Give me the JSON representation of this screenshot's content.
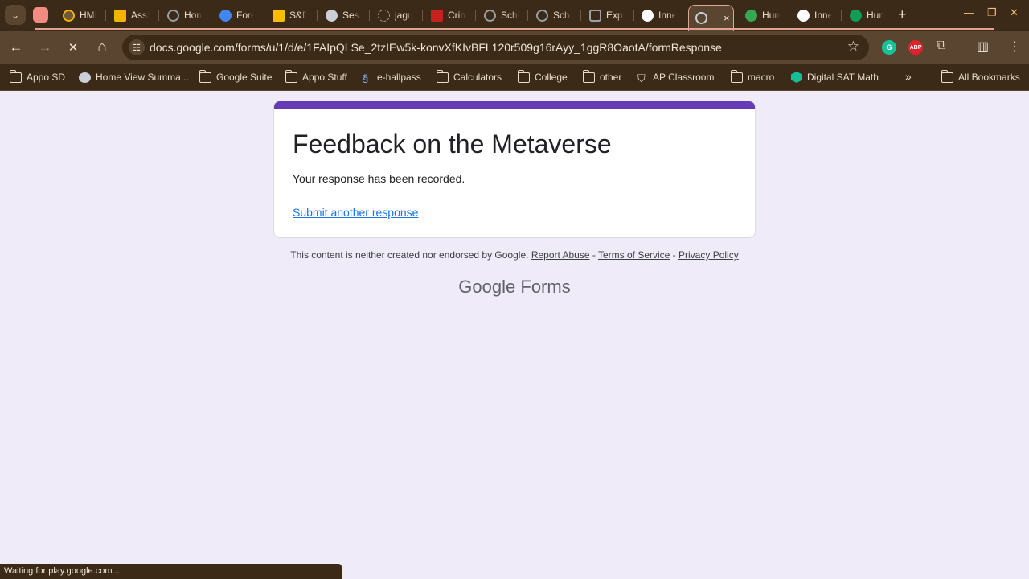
{
  "tabs": [
    {
      "label": "HMI",
      "fav_color": "#f4b400"
    },
    {
      "label": "Assignments",
      "fav_color": "#f4b400"
    },
    {
      "label": "Home",
      "fav_color": "#9aa0a6"
    },
    {
      "label": "Forest",
      "fav_color": "#4285f4"
    },
    {
      "label": "S&D",
      "fav_color": "#fbbc04"
    },
    {
      "label": "Session",
      "fav_color": "#9aa0a6"
    },
    {
      "label": "jaguar",
      "fav_color": "#9aa0a6"
    },
    {
      "label": "Crim",
      "fav_color": "#c5221f"
    },
    {
      "label": "School",
      "fav_color": "#9aa0a6"
    },
    {
      "label": "School",
      "fav_color": "#9aa0a6"
    },
    {
      "label": "Explore",
      "fav_color": "#9aa0a6"
    },
    {
      "label": "Inner",
      "fav_color": "#ffffff"
    },
    {
      "label": "Hunt",
      "fav_color": "#34a853"
    },
    {
      "label": "Inner",
      "fav_color": "#ffffff"
    },
    {
      "label": "Hunt",
      "fav_color": "#0f9d58"
    }
  ],
  "active_tab": {
    "close": "×"
  },
  "new_tab": "+",
  "window": {
    "minimize": "—",
    "restore": "❐",
    "close": "✕"
  },
  "toolbar": {
    "back": "←",
    "forward": "→",
    "stop": "✕",
    "home": "⌂",
    "site_info": "☷",
    "url": "docs.google.com/forms/u/1/d/e/1FAIpQLSe_2tzIEw5k-konvXfKIvBFL120r509g16rAyy_1ggR8OaotA/formResponse",
    "star": "☆",
    "ext_grammarly": "G",
    "ext_abp": "ABP",
    "puzzle": "⧉",
    "sidepanel": "▥",
    "menu": "⋮"
  },
  "bookmarks": [
    {
      "label": "Appo SD",
      "icon": "folder"
    },
    {
      "label": "Home View Summa...",
      "icon": "globe"
    },
    {
      "label": "Google Suite",
      "icon": "folder"
    },
    {
      "label": "Appo Stuff",
      "icon": "folder"
    },
    {
      "label": "e-hallpass",
      "icon": "link"
    },
    {
      "label": "Calculators",
      "icon": "folder"
    },
    {
      "label": "College",
      "icon": "folder"
    },
    {
      "label": "other",
      "icon": "folder"
    },
    {
      "label": "AP Classroom",
      "icon": "shield"
    },
    {
      "label": "macro",
      "icon": "folder"
    },
    {
      "label": "Digital SAT Math",
      "icon": "khan"
    }
  ],
  "bookmarks_more": "»",
  "all_bookmarks": "All Bookmarks",
  "form": {
    "title": "Feedback on the Metaverse",
    "confirmation": "Your response has been recorded.",
    "submit_another": "Submit another response",
    "accent_color": "#673ab7"
  },
  "footer": {
    "disclaimer": "This content is neither created nor endorsed by Google.",
    "report_abuse": "Report Abuse",
    "terms": "Terms of Service",
    "privacy": "Privacy Policy",
    "sep1": " - ",
    "sep2": " - ",
    "brand_google": "Google",
    "brand_forms": "Forms"
  },
  "status_text": "Waiting for play.google.com..."
}
